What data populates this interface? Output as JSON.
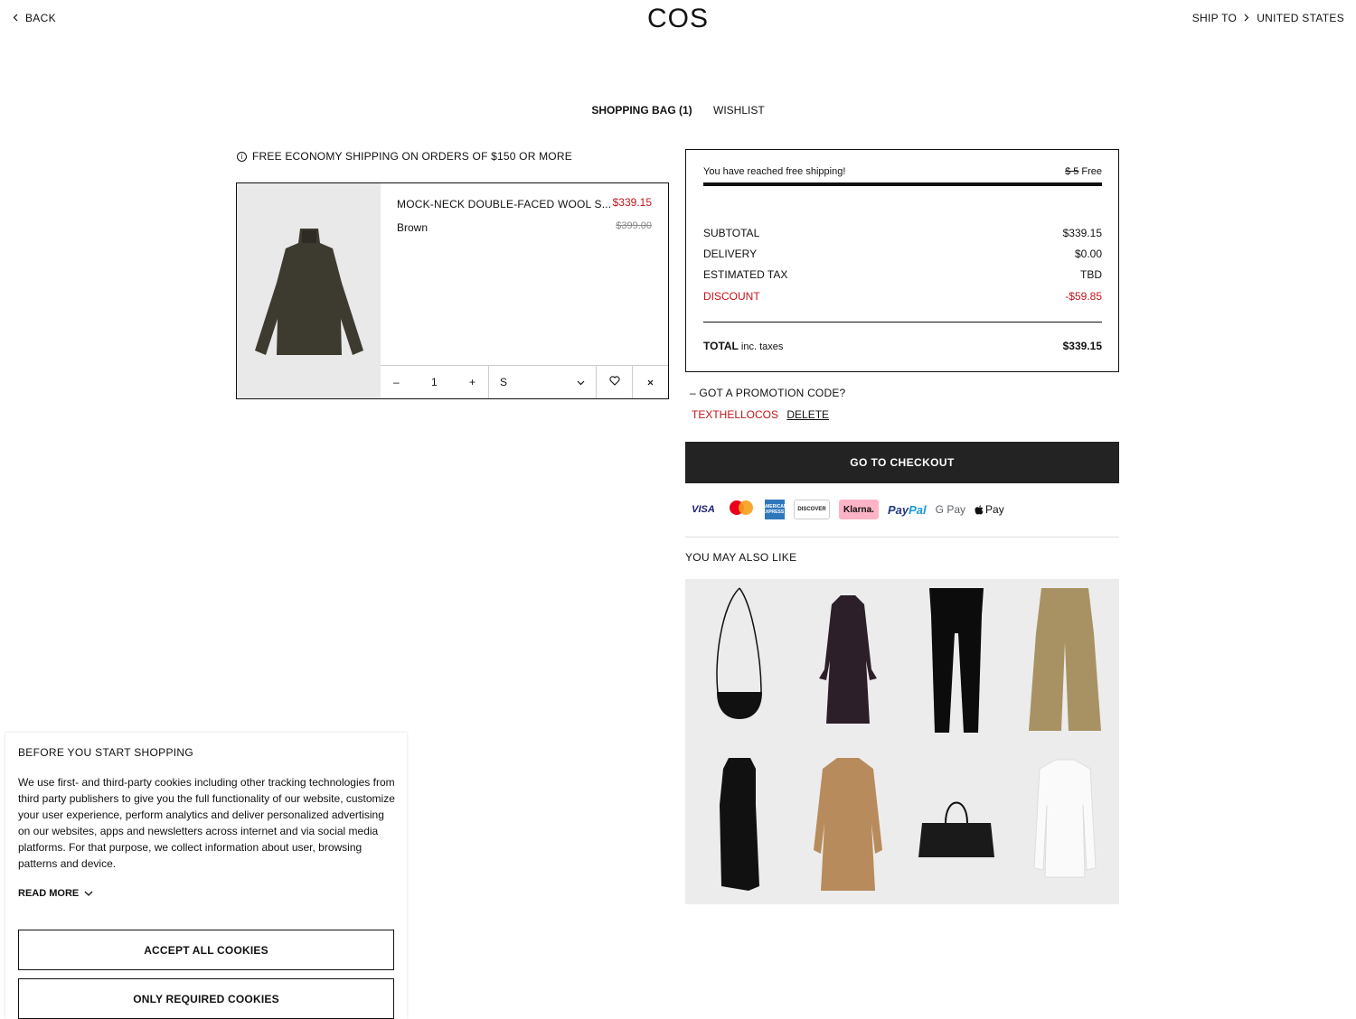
{
  "header": {
    "back_label": "BACK",
    "logo": "COS",
    "ship_to_label": "SHIP TO",
    "country": "UNITED STATES"
  },
  "tabs": {
    "bag": "SHOPPING BAG (1)",
    "wishlist": "WISHLIST"
  },
  "shipping_note": "FREE ECONOMY SHIPPING ON ORDERS OF $150 OR MORE",
  "cart_item": {
    "name": "MOCK-NECK DOUBLE-FACED WOOL S...",
    "price": "$339.15",
    "original_price": "$399.00",
    "color": "Brown",
    "quantity": "1",
    "size": "S",
    "qty_minus": "–",
    "qty_plus": "+"
  },
  "summary": {
    "free_shipping_msg": "You have reached free shipping!",
    "old_shipping": "$ 5",
    "new_shipping": "Free",
    "free_shipping_progress": 1.0,
    "subtotal_label": "SUBTOTAL",
    "subtotal_value": "$339.15",
    "delivery_label": "DELIVERY",
    "delivery_value": "$0.00",
    "tax_label": "ESTIMATED TAX",
    "tax_value": "TBD",
    "discount_label": "DISCOUNT",
    "discount_value": "-$59.85",
    "total_label": "TOTAL",
    "total_note": "inc. taxes",
    "total_value": "$339.15"
  },
  "promo": {
    "toggle_label": "–  GOT A PROMOTION CODE?",
    "code": "TEXTHELLOCOS",
    "delete_label": "DELETE"
  },
  "checkout_label": "GO TO CHECKOUT",
  "payments": {
    "visa": "VISA",
    "amex": "AMERICAN EXPRESS",
    "discover": "DISCOVER",
    "klarna": "Klarna.",
    "paypal_a": "Pay",
    "paypal_b": "Pal",
    "gpay": "G Pay",
    "apay": " Pay"
  },
  "recommendations": {
    "title": "YOU MAY ALSO LIKE",
    "items": [
      "bag-crossbody",
      "wrap-coat-burgundy",
      "leggings-black",
      "wide-trousers-khaki",
      "dress-black",
      "coat-camel",
      "tote-bag-black",
      "top-white"
    ]
  },
  "cookie_banner": {
    "title": "BEFORE YOU START SHOPPING",
    "text": "We use first- and third-party cookies including other tracking technologies from third party publishers to give you the full functionality of our website, customize your user experience, perform analytics and deliver personalized advertising on our websites, apps and newsletters across internet and via social media platforms. For that purpose, we collect information about user, browsing patterns and device.",
    "read_more": "READ MORE",
    "accept_all": "ACCEPT ALL COOKIES",
    "only_required": "ONLY REQUIRED COOKIES"
  },
  "colors": {
    "discount_red": "#c4121a",
    "checkout_bg": "#232323"
  }
}
